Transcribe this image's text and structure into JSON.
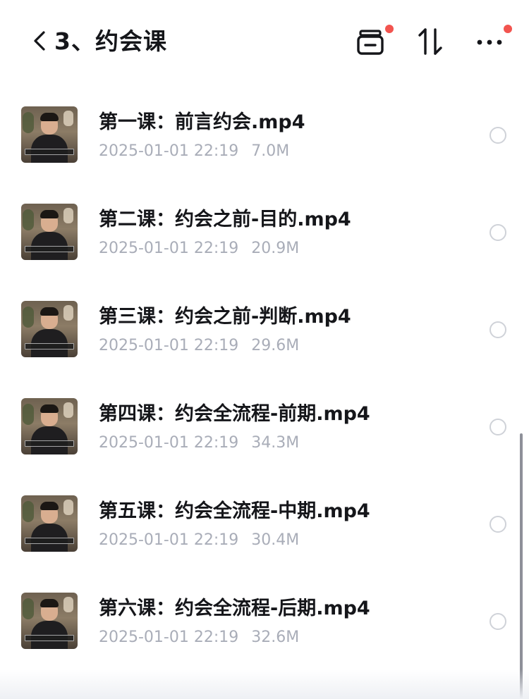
{
  "header": {
    "title": "3、约会课"
  },
  "files": [
    {
      "name": "第一课：前言约会.mp4",
      "date": "2025-01-01 22:19",
      "size": "7.0M"
    },
    {
      "name": "第二课：约会之前-目的.mp4",
      "date": "2025-01-01 22:19",
      "size": "20.9M"
    },
    {
      "name": "第三课：约会之前-判断.mp4",
      "date": "2025-01-01 22:19",
      "size": "29.6M"
    },
    {
      "name": "第四课：约会全流程-前期.mp4",
      "date": "2025-01-01 22:19",
      "size": "34.3M"
    },
    {
      "name": "第五课：约会全流程-中期.mp4",
      "date": "2025-01-01 22:19",
      "size": "30.4M"
    },
    {
      "name": "第六课：约会全流程-后期.mp4",
      "date": "2025-01-01 22:19",
      "size": "32.6M"
    }
  ],
  "icons": {
    "back": "chevron-left-icon",
    "card_view": "card-view-icon",
    "sort": "sort-icon",
    "more": "more-icon",
    "file_thumb": "video-thumbnail",
    "select": "radio-circle-icon"
  },
  "colors": {
    "title_text": "#15161a",
    "meta_text": "#a9adb8",
    "badge_dot": "#f2544f",
    "radio_border": "#cfd2d8"
  }
}
